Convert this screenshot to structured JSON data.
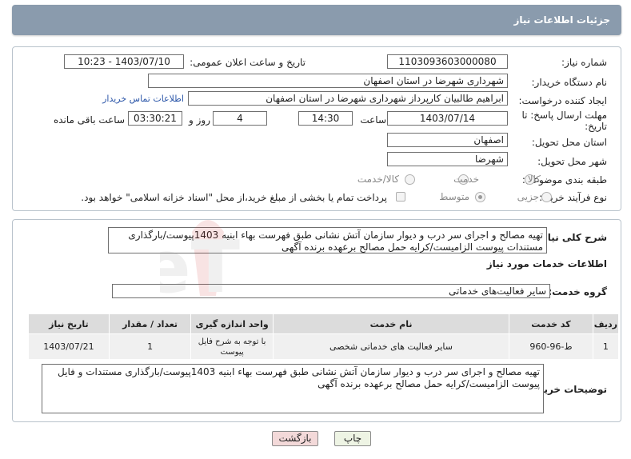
{
  "header": {
    "title": "جزئیات اطلاعات نیاز"
  },
  "form": {
    "need_number_label": "شماره نیاز:",
    "need_number": "1103093603000080",
    "announce_label": "تاریخ و ساعت اعلان عمومی:",
    "announce_value": "1403/07/10 - 10:23",
    "buyer_org_label": "نام دستگاه خریدار:",
    "buyer_org": "شهرداری شهرضا در استان اصفهان",
    "creator_label": "ایجاد کننده درخواست:",
    "creator": "ابراهیم طالبیان کارپرداز شهرداری شهرضا در استان اصفهان",
    "contact_link": "اطلاعات تماس خریدار",
    "deadline_label_1": "مهلت ارسال پاسخ: تا",
    "deadline_label_2": "تاریخ:",
    "deadline_date": "1403/07/14",
    "time_label": "ساعت",
    "deadline_time": "14:30",
    "days_value": "4",
    "days_label": "روز و",
    "remaining_time": "03:30:21",
    "remaining_label": "ساعت باقی مانده",
    "province_label": "استان محل تحویل:",
    "province": "اصفهان",
    "city_label": "شهر محل تحویل:",
    "city": "شهرضا",
    "category_label": "طبقه بندی موضوعی:",
    "category_options": [
      "کالا",
      "خدمت",
      "کالا/خدمت"
    ],
    "process_label": "نوع فرآیند خرید :",
    "process_options": [
      "جزیی",
      "متوسط"
    ],
    "payment_note": "پرداخت تمام یا بخشی از مبلغ خرید،از محل \"اسناد خزانه اسلامی\" خواهد بود."
  },
  "summary": {
    "label": "شرح کلی نیاز:",
    "text": "تهیه مصالح و اجرای سر درب و دیوار سازمان آتش نشانی طبق فهرست بهاء ابنیه 1403پیوست/بارگذاری مستندات پیوست الزامیست/کرایه حمل مصالح برعهده برنده آگهی"
  },
  "services": {
    "section_title": "اطلاعات خدمات مورد نیاز",
    "group_label": "گروه خدمت:",
    "group_value": "سایر فعالیت‌های خدماتی",
    "columns": [
      "ردیف",
      "کد خدمت",
      "نام خدمت",
      "واحد اندازه گیری",
      "تعداد / مقدار",
      "تاریخ نیاز"
    ],
    "rows": [
      {
        "row": "1",
        "code": "ط-96-960",
        "name": "سایر فعالیت های خدماتی شخصی",
        "unit": "با توجه به شرح فایل پیوست",
        "qty": "1",
        "date": "1403/07/21"
      }
    ]
  },
  "buyer_notes": {
    "label": "توضیحات خریدار:",
    "text": "تهیه مصالح و اجرای سر درب و دیوار سازمان آتش نشانی طبق فهرست بهاء ابنیه 1403پیوست/بارگذاری مستندات و فایل پیوست الزامیست/کرایه حمل مصالح برعهده برنده آگهی"
  },
  "buttons": {
    "print": "چاپ",
    "back": "بازگشت"
  },
  "watermark": "AriaTender.neT",
  "colors": {
    "header": "#8a9bad",
    "back_button": "#f3d9d9",
    "print_button": "#eef4e4",
    "link": "#2a55a8"
  }
}
